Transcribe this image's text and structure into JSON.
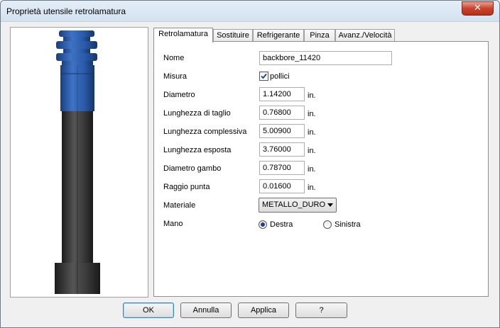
{
  "window": {
    "title": "Proprietà utensile retrolamatura",
    "close_label": "✕"
  },
  "tabs": [
    {
      "label": "Retrolamatura",
      "active": true
    },
    {
      "label": "Sostituire",
      "active": false
    },
    {
      "label": "Refrigerante",
      "active": false
    },
    {
      "label": "Pinza",
      "active": false
    },
    {
      "label": "Avanz./Velocità",
      "active": false
    }
  ],
  "form": {
    "name": {
      "label": "Nome",
      "value": "backbore_11420"
    },
    "measure": {
      "label": "Misura",
      "checkbox_label": "pollici",
      "checked": true
    },
    "diameter": {
      "label": "Diametro",
      "value": "1.14200",
      "unit": "in."
    },
    "cut_length": {
      "label": "Lunghezza di taglio",
      "value": "0.76800",
      "unit": "in."
    },
    "overall_length": {
      "label": "Lunghezza complessiva",
      "value": "5.00900",
      "unit": "in."
    },
    "exposed_length": {
      "label": "Lunghezza esposta",
      "value": "3.76000",
      "unit": "in."
    },
    "shank_diameter": {
      "label": "Diametro gambo",
      "value": "0.78700",
      "unit": "in."
    },
    "tip_radius": {
      "label": "Raggio punta",
      "value": "0.01600",
      "unit": "in."
    },
    "material": {
      "label": "Materiale",
      "value": "METALLO_DURO"
    },
    "hand": {
      "label": "Mano",
      "options": [
        "Destra",
        "Sinistra"
      ],
      "selected": "Destra"
    }
  },
  "buttons": {
    "ok": "OK",
    "cancel": "Annulla",
    "apply": "Applica",
    "help": "?"
  },
  "colors": {
    "tool_holder": "#2a5aa8",
    "tool_body": "#3c3c3c",
    "default_button": "#3c7fb1"
  },
  "icons": {
    "close": "close-icon",
    "checkbox": "checkmark-icon",
    "select": "chevron-down-icon"
  }
}
